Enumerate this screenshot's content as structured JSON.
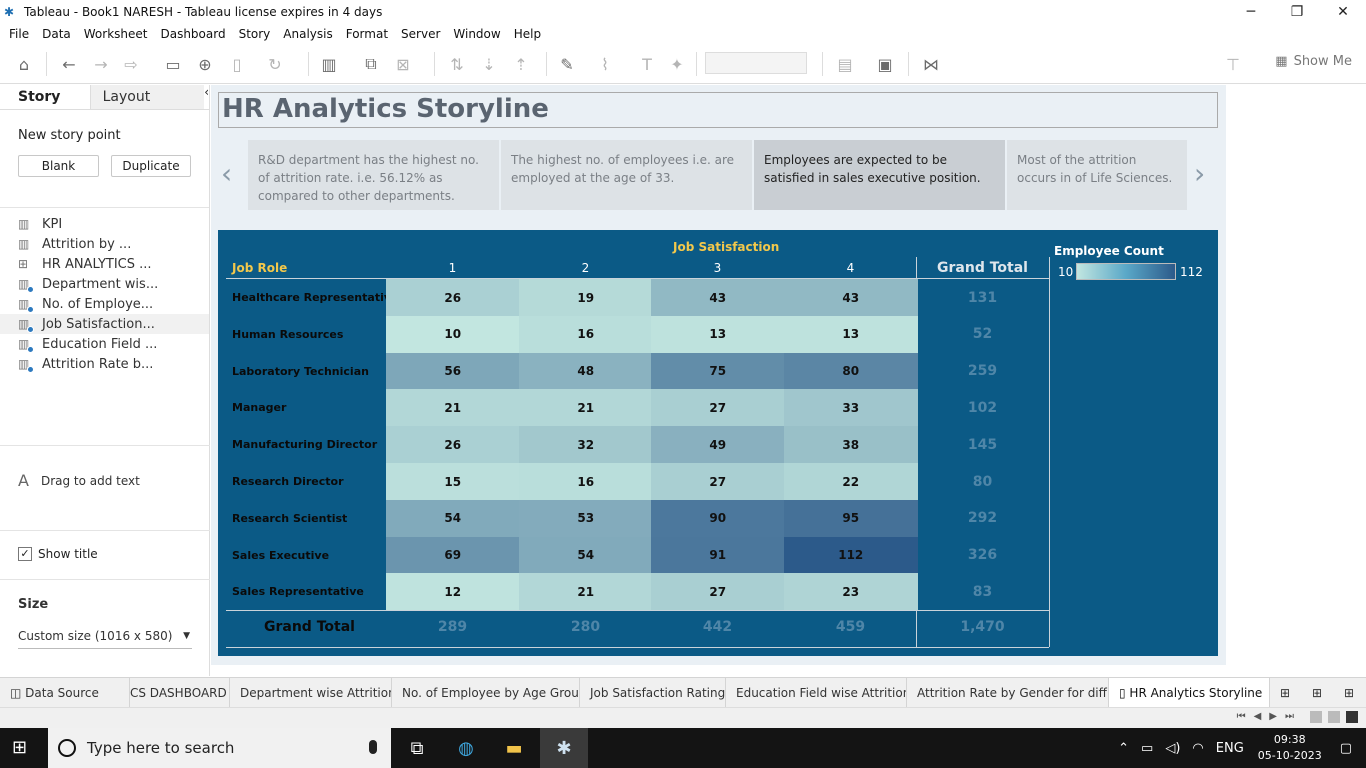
{
  "window": {
    "title": "Tableau - Book1 NARESH - Tableau license expires in 4 days",
    "minimize": "─",
    "maximize": "❐",
    "close": "✕"
  },
  "menu": [
    "File",
    "Data",
    "Worksheet",
    "Dashboard",
    "Story",
    "Analysis",
    "Format",
    "Server",
    "Window",
    "Help"
  ],
  "toolbar": {
    "show_me": "Show Me"
  },
  "left_panel": {
    "tab_story": "Story",
    "tab_layout": "Layout",
    "collapse": "‹",
    "new_story_point": "New story point",
    "blank": "Blank",
    "duplicate": "Duplicate",
    "sheets": [
      {
        "label": "KPI",
        "icon": "dashboard-icon"
      },
      {
        "label": "Attrition by ...",
        "icon": "dashboard-icon"
      },
      {
        "label": "HR ANALYTICS ...",
        "icon": "dashboard-grid-icon"
      },
      {
        "label": "Department wis...",
        "icon": "worksheet-icon"
      },
      {
        "label": "No. of Employe...",
        "icon": "worksheet-icon"
      },
      {
        "label": "Job Satisfaction...",
        "icon": "worksheet-icon"
      },
      {
        "label": "Education Field ...",
        "icon": "worksheet-icon"
      },
      {
        "label": "Attrition Rate b...",
        "icon": "worksheet-icon"
      }
    ],
    "drag_text": "Drag to add text",
    "show_title": "Show title",
    "show_title_checked": "✓",
    "size_label": "Size",
    "size_value": "Custom size (1016 x 580)"
  },
  "story": {
    "title": "HR Analytics Storyline",
    "points": [
      "R&D department has the highest no. of attrition rate. i.e. 56.12% as compared to other departments.",
      "The highest no. of employees i.e. are employed at the age of 33.",
      "Employees are expected to be satisfied in sales executive position.",
      "Most of the attrition occurs in of Life Sciences."
    ]
  },
  "chart_data": {
    "type": "heatmap",
    "title": "Job Satisfaction",
    "row_header": "Job Role",
    "columns": [
      "1",
      "2",
      "3",
      "4"
    ],
    "grand_total_label": "Grand Total",
    "rows": [
      {
        "role": "Healthcare Representative",
        "values": [
          26,
          19,
          43,
          43
        ],
        "total": "131"
      },
      {
        "role": "Human Resources",
        "values": [
          10,
          16,
          13,
          13
        ],
        "total": "52"
      },
      {
        "role": "Laboratory Technician",
        "values": [
          56,
          48,
          75,
          80
        ],
        "total": "259"
      },
      {
        "role": "Manager",
        "values": [
          21,
          21,
          27,
          33
        ],
        "total": "102"
      },
      {
        "role": "Manufacturing Director",
        "values": [
          26,
          32,
          49,
          38
        ],
        "total": "145"
      },
      {
        "role": "Research Director",
        "values": [
          15,
          16,
          27,
          22
        ],
        "total": "80"
      },
      {
        "role": "Research Scientist",
        "values": [
          54,
          53,
          90,
          95
        ],
        "total": "292"
      },
      {
        "role": "Sales Executive",
        "values": [
          69,
          54,
          91,
          112
        ],
        "total": "326"
      },
      {
        "role": "Sales Representative",
        "values": [
          12,
          21,
          27,
          23
        ],
        "total": "83"
      }
    ],
    "column_totals": [
      "289",
      "280",
      "442",
      "459"
    ],
    "overall_total": "1,470",
    "legend": {
      "title": "Employee Count",
      "min": 10,
      "max": 112,
      "color_low": "#c2e6e0",
      "color_high": "#2c5a8a"
    }
  },
  "bottom_tabs": [
    "Data Source",
    "CS DASHBOARD",
    "Department wise Attrition",
    "No. of Employee by Age Group",
    "Job Satisfaction Rating",
    "Education Field wise Attrition",
    "Attrition Rate by Gender for diff...",
    "HR Analytics Storyline"
  ],
  "taskbar": {
    "search_placeholder": "Type here to search",
    "language": "ENG",
    "time": "09:38",
    "date": "05-10-2023"
  }
}
